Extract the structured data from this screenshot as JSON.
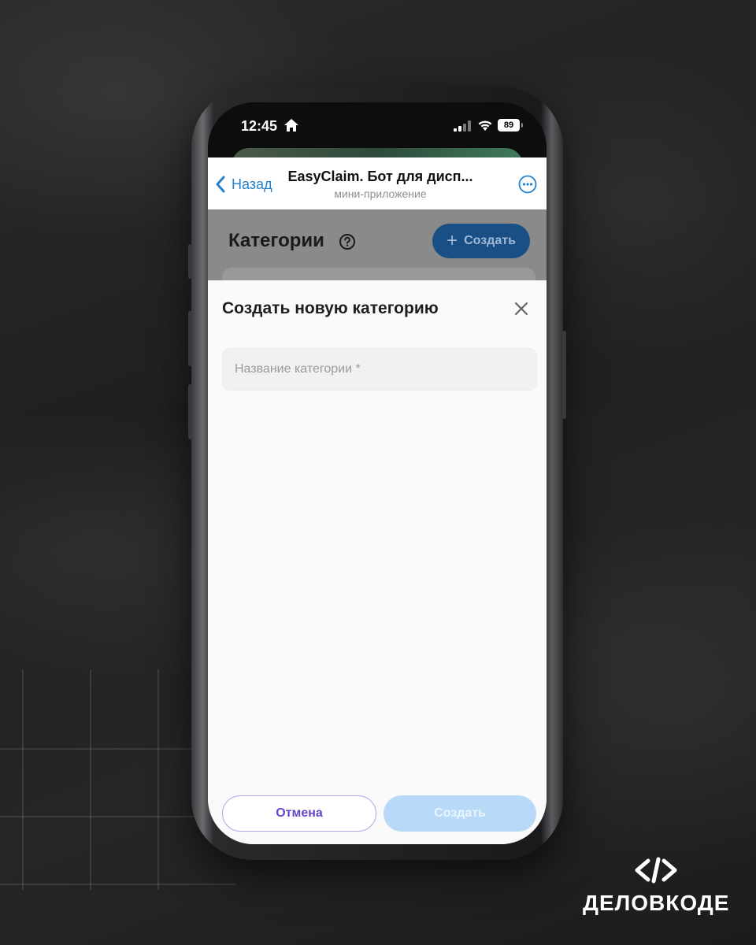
{
  "status_bar": {
    "time": "12:45",
    "battery": "89"
  },
  "header": {
    "back_label": "Назад",
    "title": "EasyClaim. Бот для дисп...",
    "subtitle": "мини-приложение"
  },
  "page": {
    "title": "Категории",
    "create_label": "Создать"
  },
  "modal": {
    "title": "Создать новую категорию",
    "name_placeholder": "Название категории *",
    "name_value": "",
    "cancel_label": "Отмена",
    "submit_label": "Создать"
  },
  "brand": {
    "name": "ДЕЛОВКОДЕ"
  },
  "colors": {
    "accent": "#2481cc",
    "submit_disabled": "#b8daf8",
    "cancel_border": "#b8a6e8",
    "cancel_text": "#6546c9"
  }
}
